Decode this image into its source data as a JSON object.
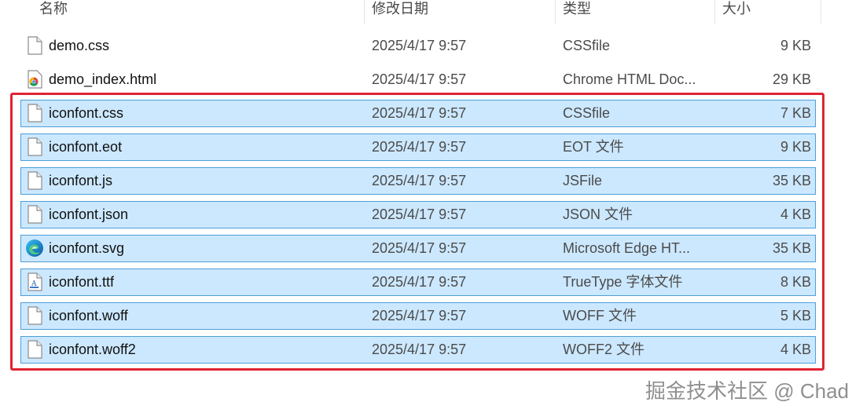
{
  "columns": {
    "name": "名称",
    "date": "修改日期",
    "type": "类型",
    "size": "大小"
  },
  "files": [
    {
      "name": "demo.css",
      "date": "2025/4/17 9:57",
      "type": "CSSfile",
      "size": "9 KB",
      "icon": "file-icon",
      "selected": false
    },
    {
      "name": "demo_index.html",
      "date": "2025/4/17 9:57",
      "type": "Chrome HTML Doc...",
      "size": "29 KB",
      "icon": "chrome-icon",
      "selected": false
    },
    {
      "name": "iconfont.css",
      "date": "2025/4/17 9:57",
      "type": "CSSfile",
      "size": "7 KB",
      "icon": "file-icon",
      "selected": true
    },
    {
      "name": "iconfont.eot",
      "date": "2025/4/17 9:57",
      "type": "EOT 文件",
      "size": "9 KB",
      "icon": "file-icon",
      "selected": true
    },
    {
      "name": "iconfont.js",
      "date": "2025/4/17 9:57",
      "type": "JSFile",
      "size": "35 KB",
      "icon": "file-icon",
      "selected": true
    },
    {
      "name": "iconfont.json",
      "date": "2025/4/17 9:57",
      "type": "JSON 文件",
      "size": "4 KB",
      "icon": "file-icon",
      "selected": true
    },
    {
      "name": "iconfont.svg",
      "date": "2025/4/17 9:57",
      "type": "Microsoft Edge HT...",
      "size": "35 KB",
      "icon": "edge-icon",
      "selected": true
    },
    {
      "name": "iconfont.ttf",
      "date": "2025/4/17 9:57",
      "type": "TrueType 字体文件",
      "size": "8 KB",
      "icon": "font-file-icon",
      "selected": true
    },
    {
      "name": "iconfont.woff",
      "date": "2025/4/17 9:57",
      "type": "WOFF 文件",
      "size": "5 KB",
      "icon": "file-icon",
      "selected": true
    },
    {
      "name": "iconfont.woff2",
      "date": "2025/4/17 9:57",
      "type": "WOFF2 文件",
      "size": "4 KB",
      "icon": "file-icon",
      "selected": true
    }
  ],
  "watermark": "掘金技术社区 @ Chad",
  "colors": {
    "selection_bg": "#cce8ff",
    "selection_border": "#4d9fd6",
    "highlight_box": "#e02332"
  }
}
